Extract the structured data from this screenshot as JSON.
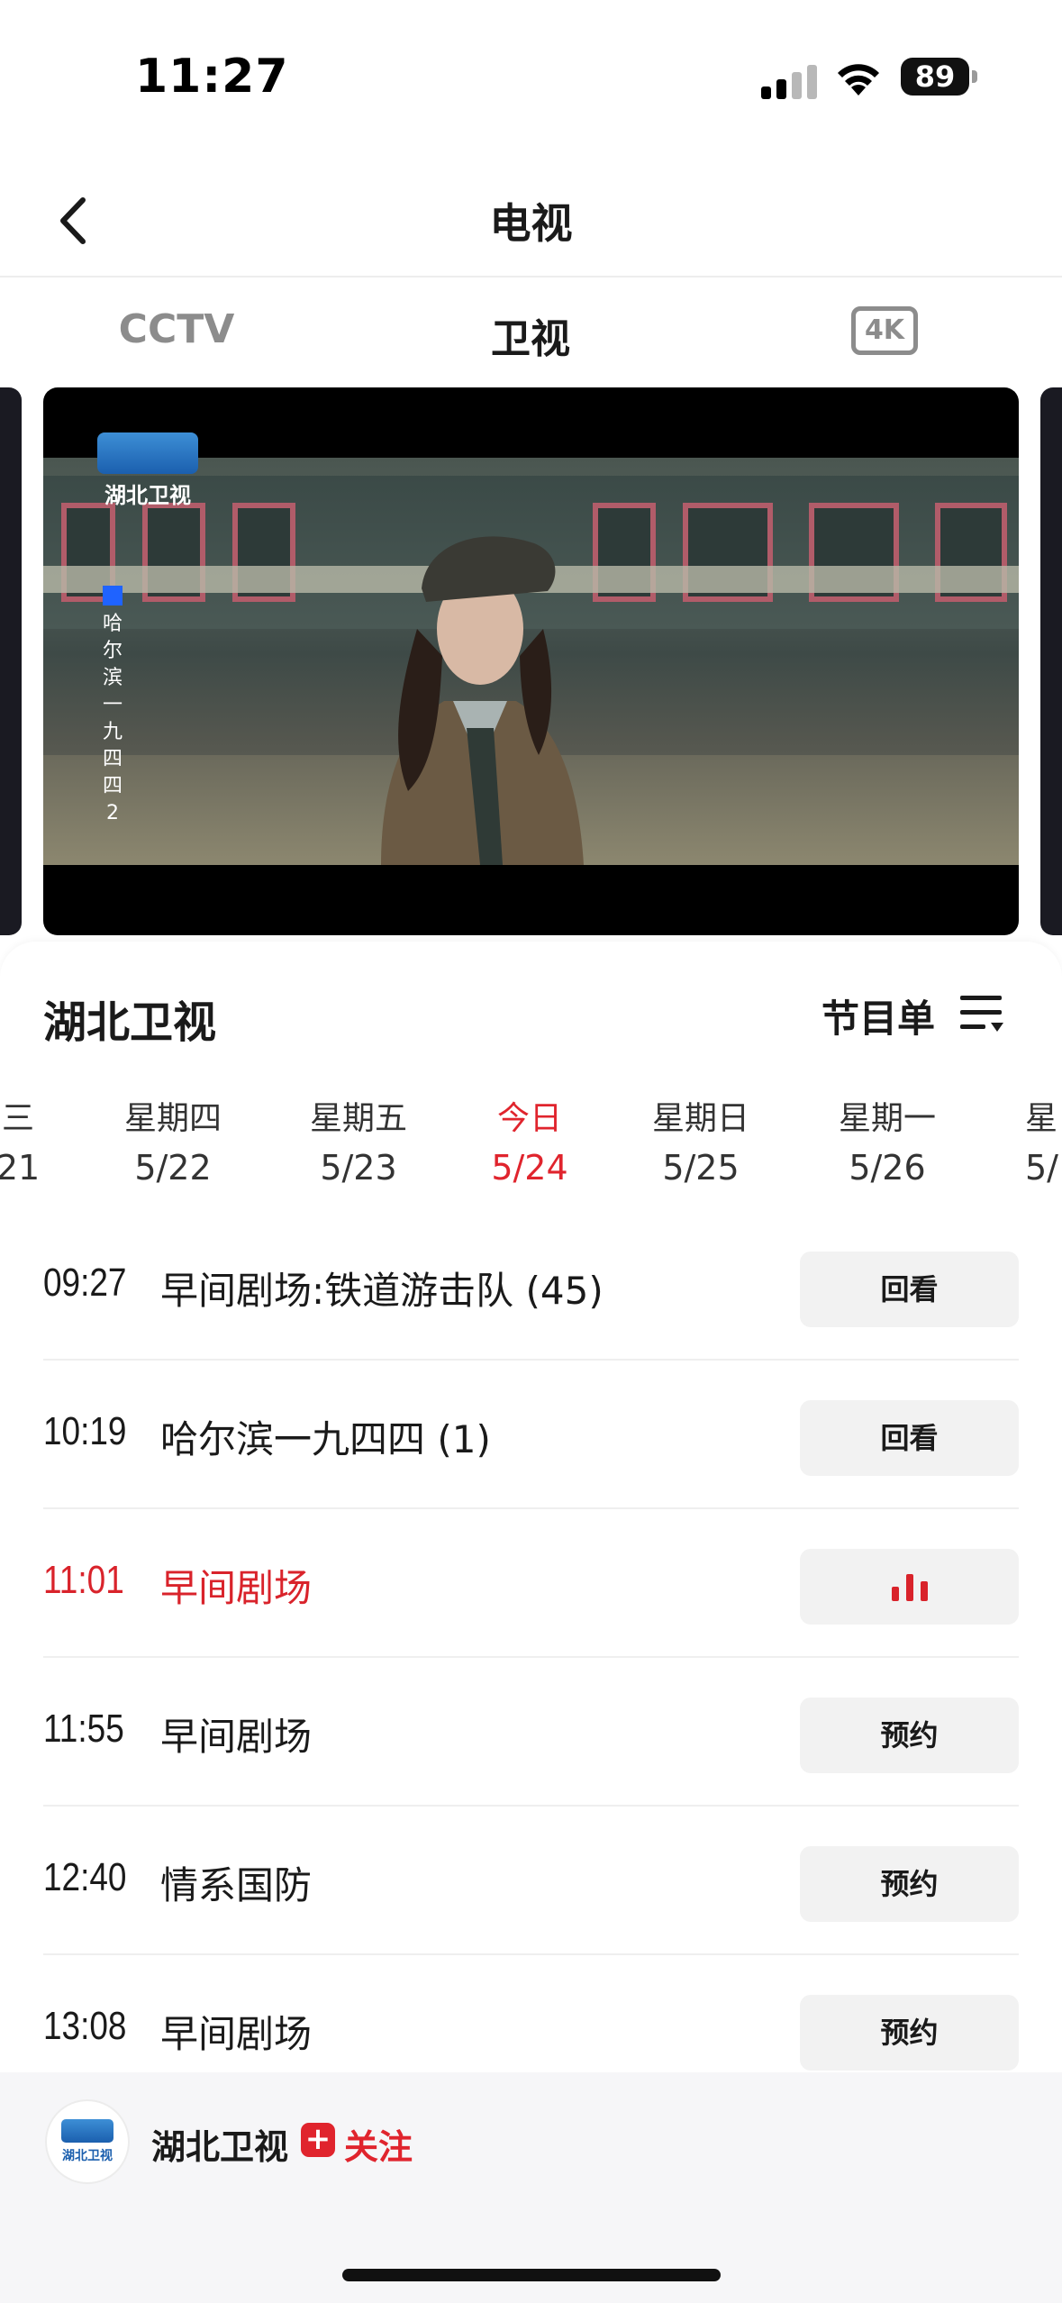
{
  "status_bar": {
    "time": "11:27",
    "battery": "89"
  },
  "nav": {
    "title": "电视"
  },
  "tabs": [
    {
      "label": "CCTV"
    },
    {
      "label": "卫视"
    },
    {
      "label": "4K"
    }
  ],
  "player": {
    "logo_text": "湖北卫视",
    "program_vertical": [
      "哈",
      "尔",
      "滨",
      "一",
      "九",
      "四",
      "四",
      "2"
    ]
  },
  "channel": {
    "name": "湖北卫视",
    "schedule_label": "节目单"
  },
  "days": [
    {
      "name": "三",
      "date": "21"
    },
    {
      "name": "星期四",
      "date": "5/22"
    },
    {
      "name": "星期五",
      "date": "5/23"
    },
    {
      "name": "今日",
      "date": "5/24"
    },
    {
      "name": "星期日",
      "date": "5/25"
    },
    {
      "name": "星期一",
      "date": "5/26"
    },
    {
      "name": "星",
      "date": "5/"
    }
  ],
  "programs": [
    {
      "time": "09:27",
      "title": "早间剧场:铁道游击队 (45)",
      "action": "回看"
    },
    {
      "time": "10:19",
      "title": "哈尔滨一九四四 (1)",
      "action": "回看"
    },
    {
      "time": "11:01",
      "title": "早间剧场",
      "action": ""
    },
    {
      "time": "11:55",
      "title": "早间剧场",
      "action": "预约"
    },
    {
      "time": "12:40",
      "title": "情系国防",
      "action": "预约"
    },
    {
      "time": "13:08",
      "title": "早间剧场",
      "action": "预约"
    }
  ],
  "footer": {
    "logo_text": "湖北卫视",
    "name": "湖北卫视",
    "follow_label": "关注"
  },
  "colors": {
    "accent": "#e0242d",
    "background": "#ffffff",
    "button_bg": "#f2f2f2"
  }
}
